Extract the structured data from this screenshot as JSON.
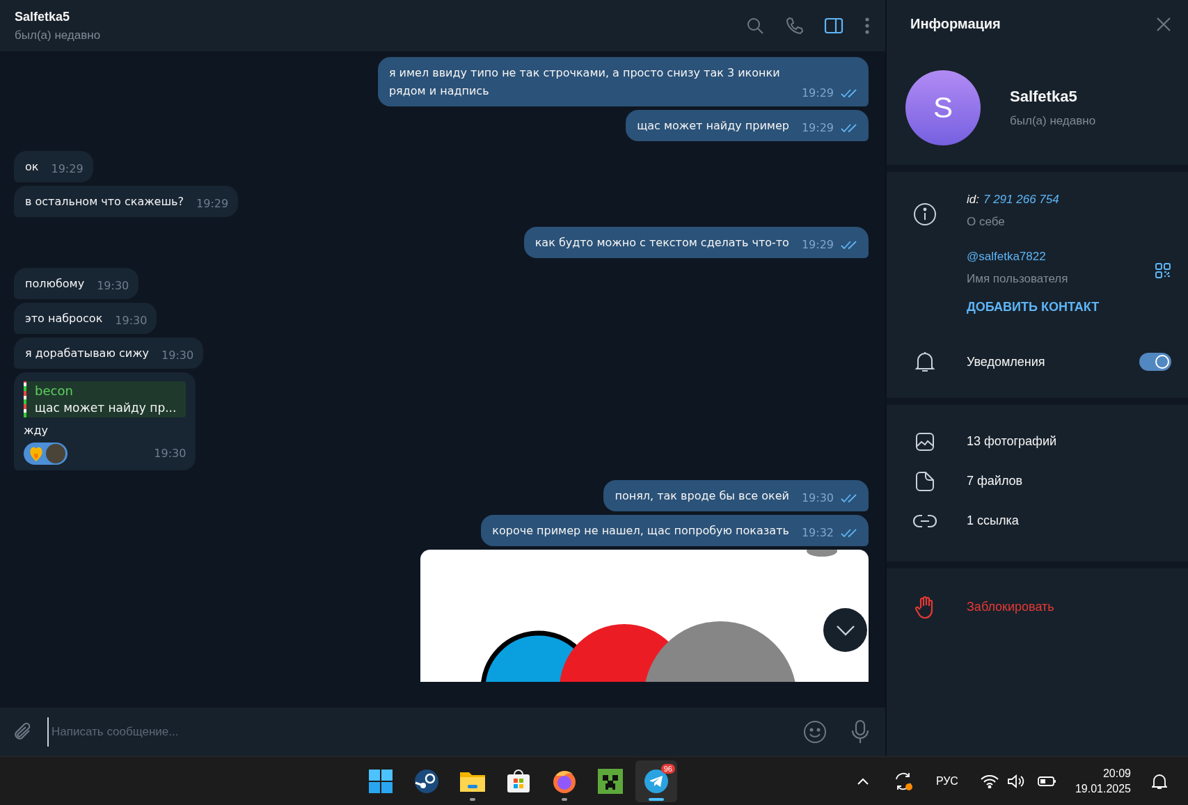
{
  "chat_header": {
    "title": "Salfetka5",
    "status": "был(а) недавно",
    "actions": [
      {
        "kind": "search",
        "active": false
      },
      {
        "kind": "call",
        "active": false
      },
      {
        "kind": "sidebar",
        "active": true
      },
      {
        "kind": "more",
        "active": false
      }
    ]
  },
  "messages": [
    {
      "kind": "text",
      "outgoing": true,
      "text": "я имел ввиду типо не так строчками, а просто снизу так 3 иконки рядом и надпись",
      "time": "19:29",
      "read": true
    },
    {
      "kind": "text",
      "outgoing": true,
      "text": "щас может найду пример",
      "time": "19:29",
      "read": true
    },
    {
      "kind": "text",
      "outgoing": false,
      "text": "ок",
      "time": "19:29"
    },
    {
      "kind": "text",
      "outgoing": false,
      "text": "в остальном что скажешь?",
      "time": "19:29"
    },
    {
      "kind": "text",
      "outgoing": true,
      "text": "как будто можно с текстом сделать что-то",
      "time": "19:29",
      "read": true
    },
    {
      "kind": "text",
      "outgoing": false,
      "text": "полюбому",
      "time": "19:30"
    },
    {
      "kind": "text",
      "outgoing": false,
      "text": "это набросок",
      "time": "19:30"
    },
    {
      "kind": "text",
      "outgoing": false,
      "text": "я дорабатываю сижу",
      "time": "19:30"
    },
    {
      "kind": "text",
      "outgoing": false,
      "reply": {
        "author": "becon",
        "text": "щас может найду пр..."
      },
      "text": "жду",
      "reaction": {
        "chosen": true
      },
      "time": "19:30"
    },
    {
      "kind": "text",
      "outgoing": true,
      "text": "понял, так вроде бы все окей",
      "time": "19:30",
      "read": true
    },
    {
      "kind": "text",
      "outgoing": true,
      "text": "короче пример не нашел, щас попробую показать",
      "time": "19:32",
      "read": true
    },
    {
      "kind": "image",
      "outgoing": true
    }
  ],
  "compose": {
    "placeholder": "Написать сообщение..."
  },
  "info_panel": {
    "title": "Информация",
    "avatar_letter": "S",
    "name": "Salfetka5",
    "status": "был(а) недавно",
    "id_label": "id:",
    "id_value": "7 291 266 754",
    "bio_label": "О себе",
    "username": "@salfetka7822",
    "username_label": "Имя пользователя",
    "add_contact": "ДОБАВИТЬ КОНТАКТ",
    "notifications": {
      "label": "Уведомления",
      "on": true
    },
    "media": [
      {
        "kind": "photos",
        "label": "13 фотографий"
      },
      {
        "kind": "files",
        "label": "7 файлов"
      },
      {
        "kind": "links",
        "label": "1 ссылка"
      }
    ],
    "block": "Заблокировать"
  },
  "taskbar": {
    "apps": [
      {
        "kind": "start",
        "running": false,
        "active": false
      },
      {
        "kind": "steam",
        "running": false,
        "active": false
      },
      {
        "kind": "explorer",
        "running": true,
        "active": false
      },
      {
        "kind": "store",
        "running": false,
        "active": false
      },
      {
        "kind": "firefox",
        "running": true,
        "active": false
      },
      {
        "kind": "minecraft",
        "running": false,
        "active": false
      },
      {
        "kind": "telegram",
        "running": true,
        "active": true,
        "badge": "96"
      }
    ],
    "language": "РУС",
    "time": "20:09",
    "date": "19.01.2025"
  }
}
